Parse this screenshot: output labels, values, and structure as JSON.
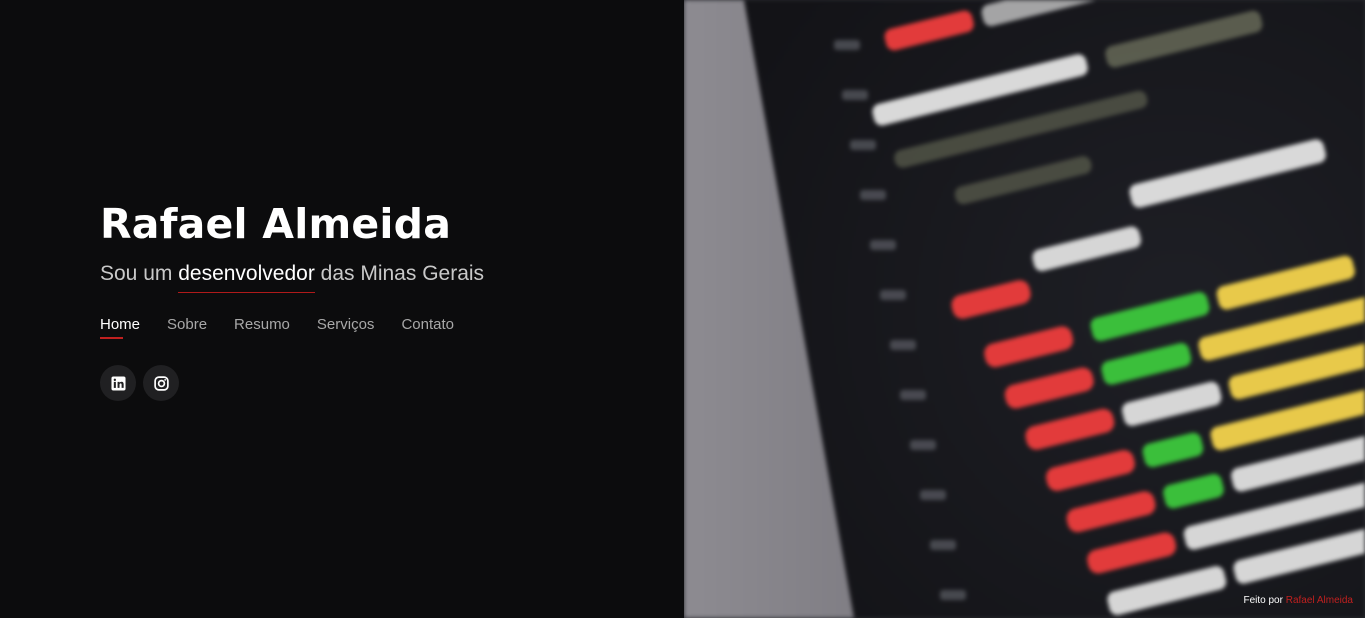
{
  "hero": {
    "name": "Rafael Almeida",
    "tagline_prefix": "Sou um ",
    "tagline_typed": "desenvolvedor",
    "tagline_suffix": " das Minas Gerais"
  },
  "nav": {
    "items": [
      {
        "label": "Home",
        "active": true
      },
      {
        "label": "Sobre",
        "active": false
      },
      {
        "label": "Resumo",
        "active": false
      },
      {
        "label": "Serviços",
        "active": false
      },
      {
        "label": "Contato",
        "active": false
      }
    ]
  },
  "social": {
    "items": [
      {
        "icon": "linkedin-icon"
      },
      {
        "icon": "instagram-icon"
      }
    ]
  },
  "credit": {
    "prefix": "Feito por",
    "author": "Rafael Almeida"
  },
  "colors": {
    "background": "#0c0c0d",
    "accent": "#c0201f",
    "text": "#ffffff",
    "muted": "#a8a8a8"
  }
}
